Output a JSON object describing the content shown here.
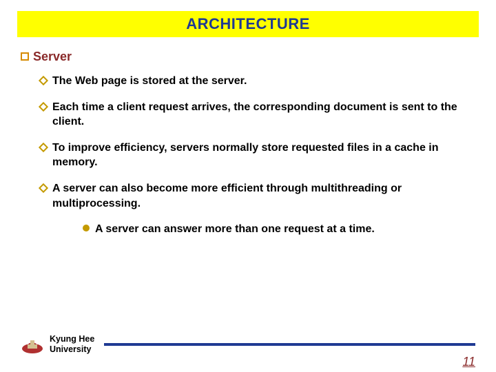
{
  "title": "ARCHITECTURE",
  "heading": "Server",
  "bullets": [
    "The Web page is stored at the server.",
    "Each time a client request arrives, the corresponding document is sent to the client.",
    "To improve efficiency, servers normally store requested files in a cache in memory.",
    "A server can also become more efficient through multithreading or multiprocessing."
  ],
  "subbullets": [
    "A server can answer more than one request at a time."
  ],
  "footer": {
    "line1": "Kyung Hee",
    "line2": "University"
  },
  "page_number": "11"
}
